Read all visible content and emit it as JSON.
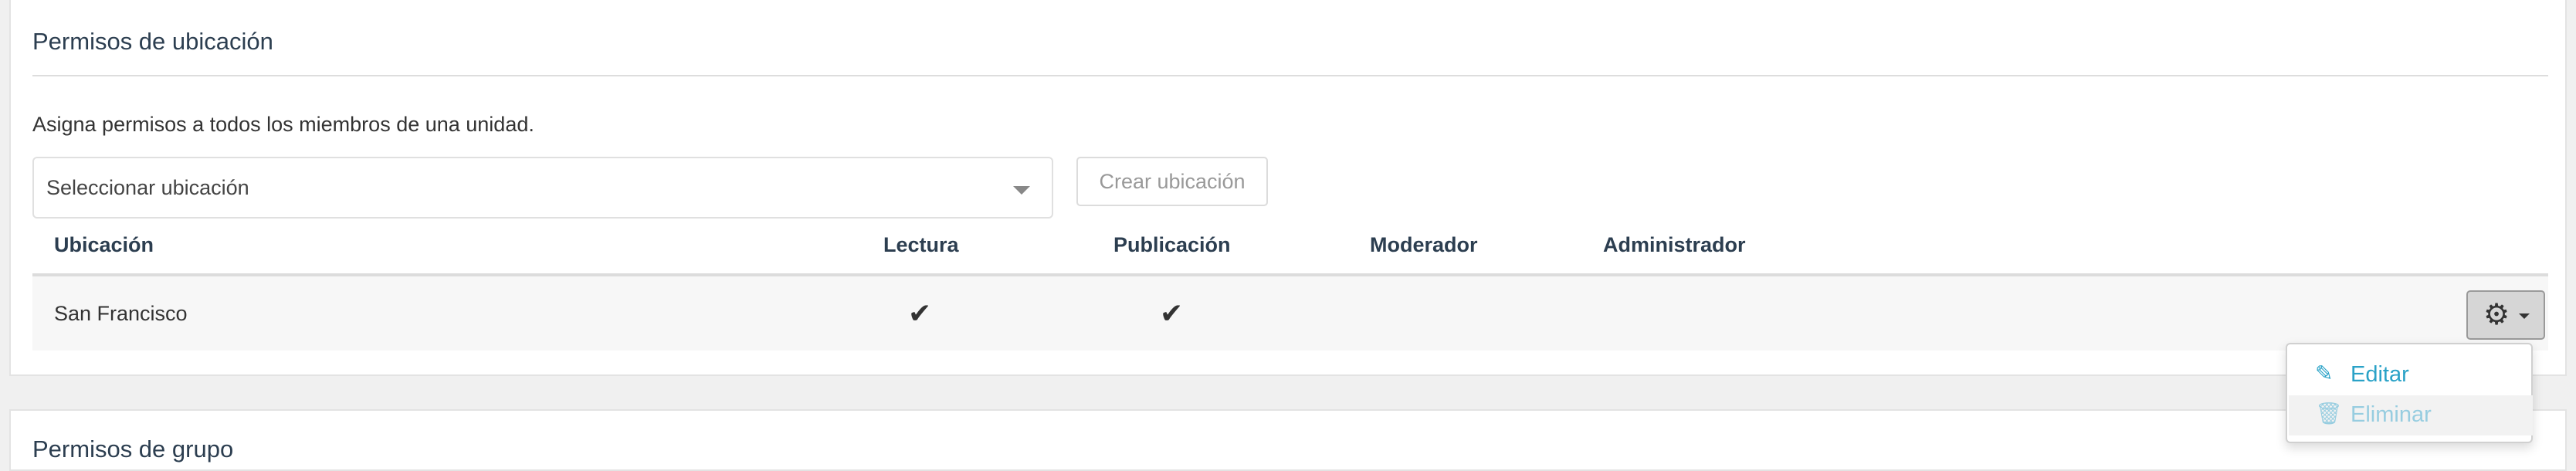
{
  "location_panel": {
    "title": "Permisos de ubicación",
    "description": "Asigna permisos a todos los miembros de una unidad.",
    "select_placeholder": "Seleccionar ubicación",
    "create_button": "Crear ubicación",
    "columns": [
      "Ubicación",
      "Lectura",
      "Publicación",
      "Moderador",
      "Administrador"
    ],
    "rows": [
      {
        "location": "San Francisco",
        "read": true,
        "publish": true,
        "moderator": false,
        "admin": false
      }
    ],
    "check_glyph": "✔",
    "gear_icon": "gear-icon",
    "menu": {
      "edit": "Editar",
      "delete": "Eliminar"
    }
  },
  "group_panel": {
    "title": "Permisos de grupo"
  },
  "colors": {
    "link": "#2aa2c7",
    "link_disabled": "#97cde0",
    "heading": "#2c3e50"
  }
}
